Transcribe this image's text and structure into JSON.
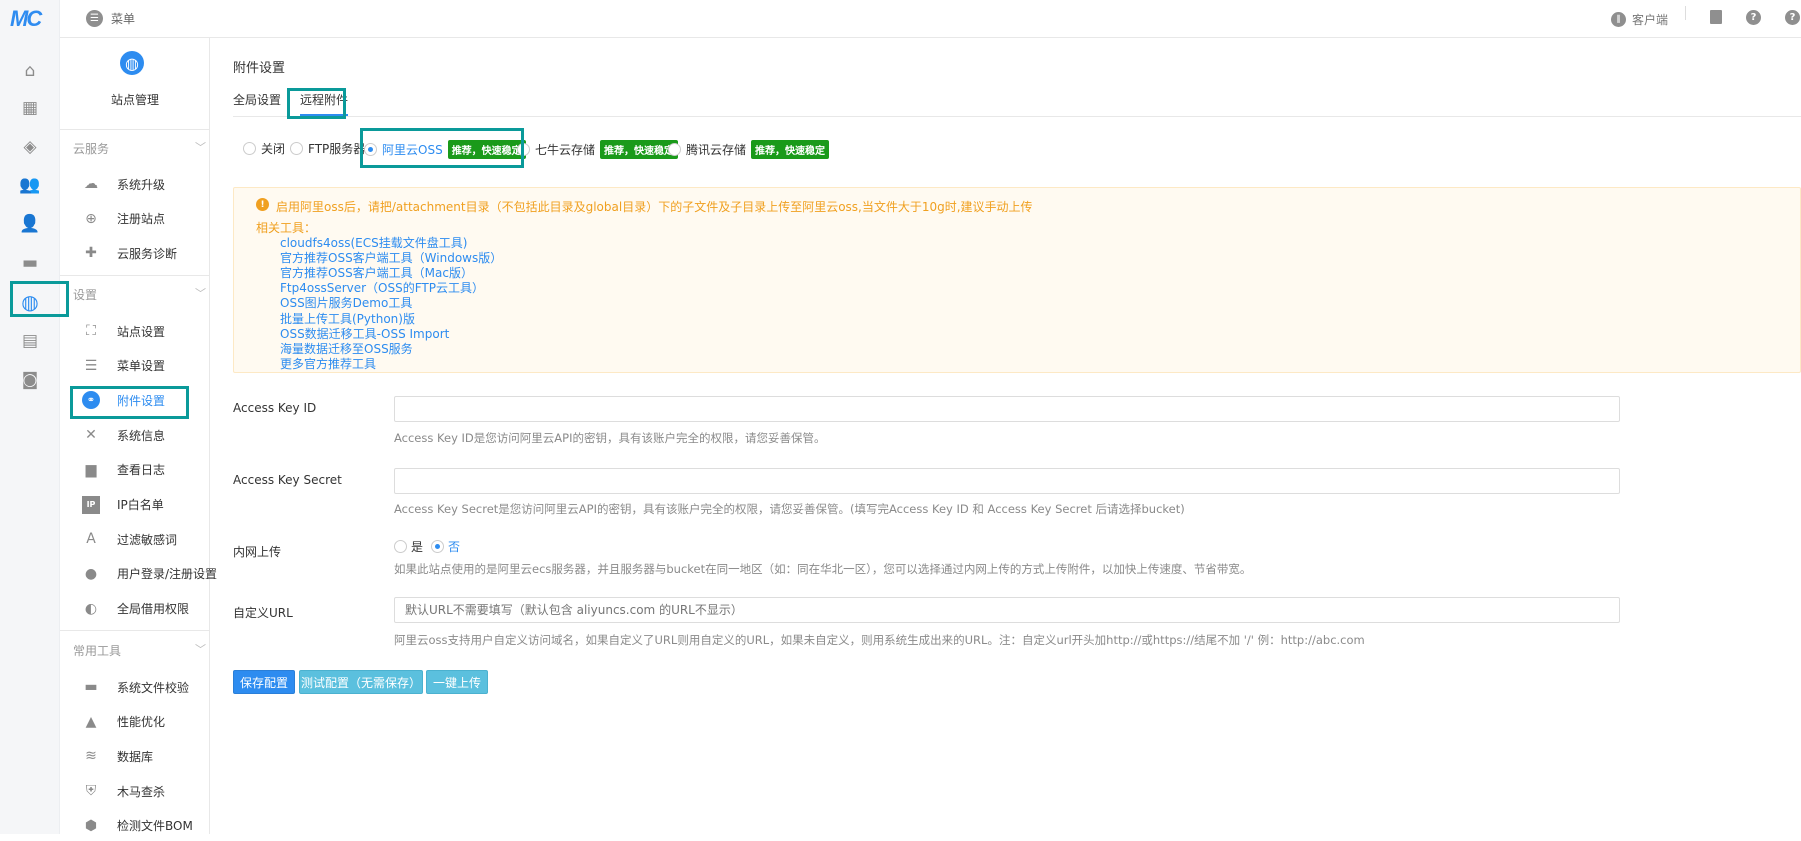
{
  "logo": "MC",
  "iconbar": [
    {
      "name": "home-icon",
      "glyph": "⌂"
    },
    {
      "name": "apps-icon",
      "glyph": "▦"
    },
    {
      "name": "cube-icon",
      "glyph": "◈"
    },
    {
      "name": "users-icon",
      "glyph": "👥"
    },
    {
      "name": "user-lock-icon",
      "glyph": "👤"
    },
    {
      "name": "monitor-icon",
      "glyph": "▬"
    },
    {
      "name": "globe-icon",
      "glyph": "◍"
    },
    {
      "name": "store-icon",
      "glyph": "▤"
    },
    {
      "name": "bag-icon",
      "glyph": "◙"
    }
  ],
  "header": {
    "menu_label": "菜单",
    "client_label": "客户端"
  },
  "sidebar": {
    "title": "站点管理",
    "groups": [
      {
        "label": "云服务",
        "items": [
          "系统升级",
          "注册站点",
          "云服务诊断"
        ]
      },
      {
        "label": "设置",
        "items": [
          "站点设置",
          "菜单设置",
          "附件设置",
          "系统信息",
          "查看日志",
          "IP白名单",
          "过滤敏感词",
          "用户登录/注册设置",
          "全局借用权限"
        ]
      },
      {
        "label": "常用工具",
        "items": [
          "系统文件校验",
          "性能优化",
          "数据库",
          "木马查杀",
          "检测文件BOM"
        ]
      }
    ],
    "active": "附件设置"
  },
  "page": {
    "title": "附件设置",
    "tabs": [
      "全局设置",
      "远程附件"
    ],
    "active_tab": "远程附件",
    "storage_options": [
      {
        "label": "关闭",
        "badge": null
      },
      {
        "label": "FTP服务器",
        "badge": null
      },
      {
        "label": "阿里云OSS",
        "badge": "推荐，快速稳定",
        "selected": true
      },
      {
        "label": "七牛云存储",
        "badge": "推荐，快速稳定"
      },
      {
        "label": "腾讯云存储",
        "badge": "推荐，快速稳定"
      }
    ],
    "notice": {
      "text": "启用阿里oss后，请把/attachment目录（不包括此目录及global目录）下的子文件及子目录上传至阿里云oss,当文件大于10g时,建议手动上传",
      "tools_label": "相关工具：",
      "tools": [
        "cloudfs4oss(ECS挂载文件盘工具)",
        "官方推荐OSS客户端工具（Windows版）",
        "官方推荐OSS客户端工具（Mac版）",
        "Ftp4ossServer（OSS的FTP云工具）",
        "OSS图片服务Demo工具",
        "批量上传工具(Python)版",
        "OSS数据迁移工具-OSS Import",
        "海量数据迁移至OSS服务",
        "更多官方推荐工具"
      ]
    },
    "fields": {
      "key_id": {
        "label": "Access Key ID",
        "value": "",
        "help": "Access Key ID是您访问阿里云API的密钥，具有该账户完全的权限，请您妥善保管。"
      },
      "key_secret": {
        "label": "Access Key Secret",
        "value": "",
        "help": "Access Key Secret是您访问阿里云API的密钥，具有该账户完全的权限，请您妥善保管。(填写完Access Key ID 和 Access Key Secret 后请选择bucket)"
      },
      "intranet": {
        "label": "内网上传",
        "yes": "是",
        "no": "否",
        "selected": "否",
        "help": "如果此站点使用的是阿里云ecs服务器，并且服务器与bucket在同一地区（如：同在华北一区），您可以选择通过内网上传的方式上传附件，以加快上传速度、节省带宽。"
      },
      "custom_url": {
        "label": "自定义URL",
        "value": "",
        "placeholder": "默认URL不需要填写（默认包含 aliyuncs.com 的URL不显示）",
        "help": "阿里云oss支持用户自定义访问域名，如果自定义了URL则用自定义的URL，如果未自定义，则用系统生成出来的URL。注：自定义url开头加http://或https://结尾不加  '/'  例：http://abc.com"
      }
    },
    "buttons": {
      "save": "保存配置",
      "test": "测试配置（无需保存）",
      "upload": "一键上传"
    }
  },
  "colors": {
    "accent": "#2d8cf0",
    "badge": "#1a9a1a",
    "highlight": "#0a9a9a",
    "warning": "#f0a020"
  }
}
